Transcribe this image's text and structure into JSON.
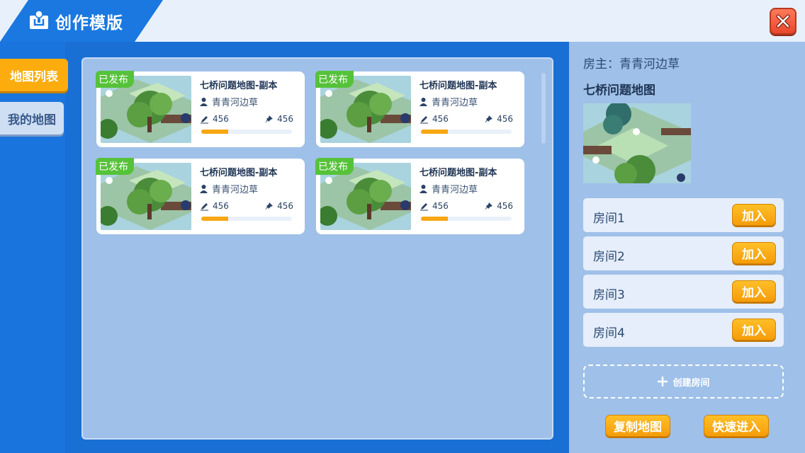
{
  "header": {
    "title": "创作模版",
    "icon": "lightbulb-icon",
    "close_icon": "close-icon"
  },
  "sidebar": {
    "items": [
      {
        "label": "地图列表",
        "active": true
      },
      {
        "label": "我的地图",
        "active": false
      }
    ]
  },
  "cards": [
    {
      "badge": "已发布",
      "title": "七桥问题地图-副本",
      "author": "青青河边草",
      "edits": "456",
      "pins": "456",
      "progress": 0.3
    },
    {
      "badge": "已发布",
      "title": "七桥问题地图-副本",
      "author": "青青河边草",
      "edits": "456",
      "pins": "456",
      "progress": 0.3
    },
    {
      "badge": "已发布",
      "title": "七桥问题地图-副本",
      "author": "青青河边草",
      "edits": "456",
      "pins": "456",
      "progress": 0.3
    },
    {
      "badge": "已发布",
      "title": "七桥问题地图-副本",
      "author": "青青河边草",
      "edits": "456",
      "pins": "456",
      "progress": 0.3
    }
  ],
  "detail": {
    "owner": "房主：青青河边草",
    "map_name": "七桥问题地图",
    "rooms": [
      {
        "label": "房间1",
        "join": "加入"
      },
      {
        "label": "房间2",
        "join": "加入"
      },
      {
        "label": "房间3",
        "join": "加入"
      },
      {
        "label": "房间4",
        "join": "加入"
      }
    ],
    "create_room": "创建房间",
    "copy_map": "复制地图",
    "quick_enter": "快速进入"
  },
  "colors": {
    "accent": "#fcac0c",
    "primary": "#1a74de",
    "panel": "#9fc0e8",
    "published": "#56c23a"
  }
}
